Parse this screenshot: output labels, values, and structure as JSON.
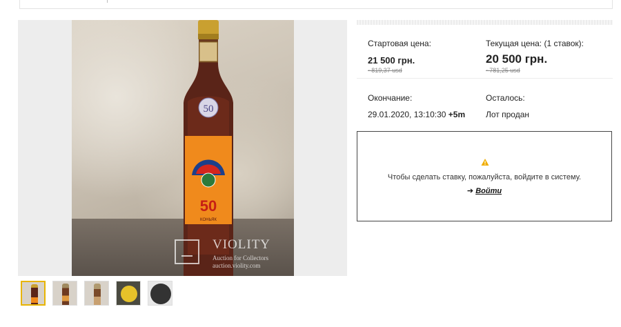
{
  "gallery": {
    "watermark": {
      "title": "VIOLITY",
      "subtitle": "Auction for Collectors",
      "url": "auction.violity.com"
    },
    "thumbnails_count": 5,
    "active_index": 0
  },
  "prices": {
    "start_label": "Стартовая цена:",
    "start_value": "21 500  грн.",
    "start_usd": "~819,37  usd",
    "current_label": "Текущая цена: (1 ставок):",
    "current_value": "20 500  грн.",
    "current_usd": "~781,25  usd"
  },
  "timing": {
    "end_label": "Окончание:",
    "end_value": "29.01.2020, 13:10:30",
    "end_extension": "+5m",
    "remaining_label": "Осталось:",
    "remaining_value": "Лот продан"
  },
  "login": {
    "icon": "warning-icon",
    "message": "Чтобы сделать ставку, пожалуйста, войдите в систему.",
    "arrow": "➔",
    "link_label": "Войти"
  },
  "colors": {
    "accent": "#e8b400",
    "warning": "#f0ad00"
  }
}
